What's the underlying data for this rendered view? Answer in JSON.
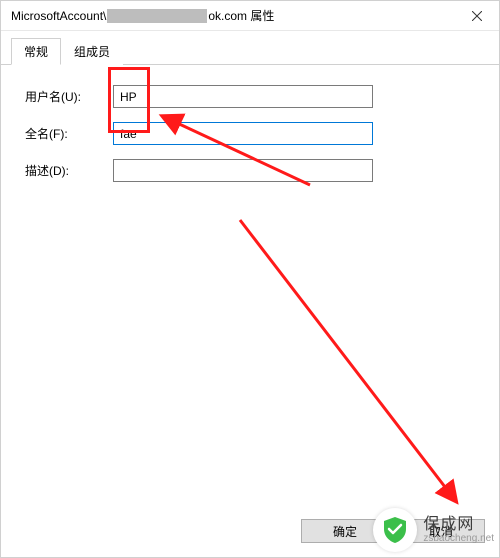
{
  "titlebar": {
    "prefix": "MicrosoftAccount\\",
    "suffix": "ok.com 属性"
  },
  "tabs": {
    "general": "常规",
    "members": "组成员"
  },
  "fields": {
    "username": {
      "label": "用户名(U):",
      "value": "HP"
    },
    "fullname": {
      "label": "全名(F):",
      "value": "fae"
    },
    "description": {
      "label": "描述(D):",
      "value": ""
    }
  },
  "buttons": {
    "ok": "确定",
    "cancel": "取消"
  },
  "watermark": {
    "cn": "保成网",
    "en": "zsbaocheng.net"
  }
}
